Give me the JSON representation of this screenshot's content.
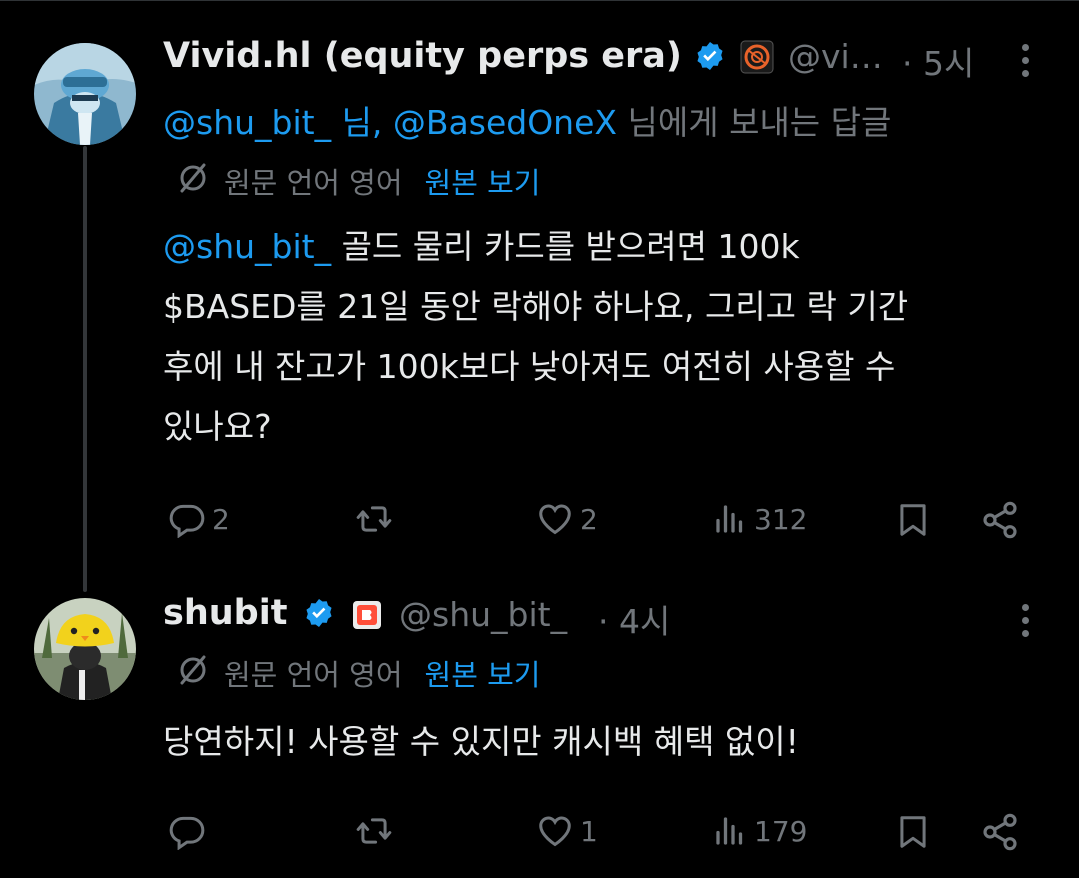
{
  "tweets": [
    {
      "name": "Vivid.hl (equity perps era)",
      "handle": "@vi…",
      "dot_time": "· 5시",
      "reply_mention_1": "@shu_bit_ 님, @BasedOneX",
      "reply_suffix": "님에게 보내는 답글",
      "original_lang": "원문 언어 영어",
      "view_original": "원본 보기",
      "body_mention": "@shu_bit_",
      "body_line1_rest": " 골드 물리 카드를 받으려면 100k",
      "body_line2": "$BASED를 21일 동안 락해야 하나요, 그리고 락 기간",
      "body_line3": "후에 내 잔고가 100k보다 낮아져도 여전히 사용할 수",
      "body_line4": "있나요?",
      "replies": "2",
      "retweets": "",
      "likes": "2",
      "views": "312"
    },
    {
      "name": "shubit",
      "handle": "@shu_bit_",
      "dot_time": "· 4시",
      "original_lang": "원문 언어 영어",
      "view_original": "원본 보기",
      "body": "당연하지! 사용할 수 있지만 캐시백 혜택 없이!",
      "replies": "",
      "retweets": "",
      "likes": "1",
      "views": "179"
    }
  ],
  "colors": {
    "background": "#000000",
    "text": "#e7e9ea",
    "muted": "#71767b",
    "link": "#1d9bf0",
    "verified": "#1d9bf0"
  },
  "icons": [
    "verified-badge-icon",
    "affiliate-badge-icon",
    "more-icon",
    "translate-icon",
    "reply-icon",
    "retweet-icon",
    "like-icon",
    "views-icon",
    "bookmark-icon",
    "share-icon"
  ]
}
